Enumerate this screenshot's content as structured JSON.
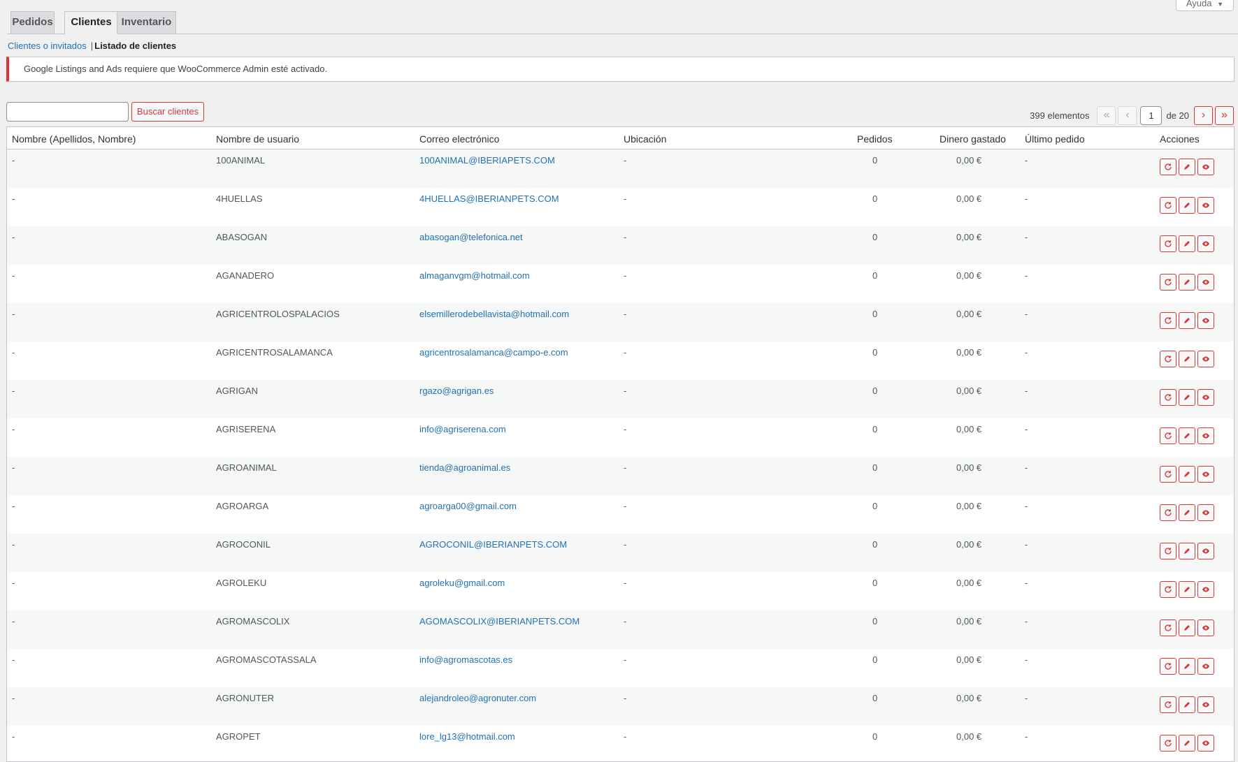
{
  "help": {
    "label": "Ayuda",
    "caret": "▼"
  },
  "tabs": [
    {
      "label": "Pedidos"
    },
    {
      "label": "Clientes"
    },
    {
      "label": "Inventario"
    }
  ],
  "subnav": {
    "link": "Clientes o invitados",
    "separator": "|",
    "current": "Listado de clientes"
  },
  "notice": "Google Listings and Ads requiere que WooCommerce Admin esté activado.",
  "search": {
    "value": "",
    "button": "Buscar clientes"
  },
  "pagination": {
    "count": "399 elementos",
    "first": "«",
    "prev": "‹",
    "current": "1",
    "of": "de 20",
    "next": "›",
    "last": "»"
  },
  "table": {
    "headers": [
      "Nombre (Apellidos, Nombre)",
      "Nombre de usuario",
      "Correo electrónico",
      "Ubicación",
      "Pedidos",
      "Dinero gastado",
      "Último pedido",
      "Acciones"
    ],
    "rows": [
      {
        "name": "-",
        "user": "100ANIMAL",
        "email": "100ANIMAL@IBERIAPETS.COM",
        "location": "-",
        "orders": "0",
        "spent": "0,00 €",
        "last": "-"
      },
      {
        "name": "-",
        "user": "4HUELLAS",
        "email": "4HUELLAS@IBERIANPETS.COM",
        "location": "-",
        "orders": "0",
        "spent": "0,00 €",
        "last": "-"
      },
      {
        "name": "-",
        "user": "ABASOGAN",
        "email": "abasogan@telefonica.net",
        "location": "-",
        "orders": "0",
        "spent": "0,00 €",
        "last": "-"
      },
      {
        "name": "-",
        "user": "AGANADERO",
        "email": "almaganvgm@hotmail.com",
        "location": "-",
        "orders": "0",
        "spent": "0,00 €",
        "last": "-"
      },
      {
        "name": "-",
        "user": "AGRICENTROLOSPALACIOS",
        "email": "elsemillerodebellavista@hotmail.com",
        "location": "-",
        "orders": "0",
        "spent": "0,00 €",
        "last": "-"
      },
      {
        "name": "-",
        "user": "AGRICENTROSALAMANCA",
        "email": "agricentrosalamanca@campo-e.com",
        "location": "-",
        "orders": "0",
        "spent": "0,00 €",
        "last": "-"
      },
      {
        "name": "-",
        "user": "AGRIGAN",
        "email": "rgazo@agrigan.es",
        "location": "-",
        "orders": "0",
        "spent": "0,00 €",
        "last": "-"
      },
      {
        "name": "-",
        "user": "AGRISERENA",
        "email": "info@agriserena.com",
        "location": "-",
        "orders": "0",
        "spent": "0,00 €",
        "last": "-"
      },
      {
        "name": "-",
        "user": "AGROANIMAL",
        "email": "tienda@agroanimal.es",
        "location": "-",
        "orders": "0",
        "spent": "0,00 €",
        "last": "-"
      },
      {
        "name": "-",
        "user": "AGROARGA",
        "email": "agroarga00@gmail.com",
        "location": "-",
        "orders": "0",
        "spent": "0,00 €",
        "last": "-"
      },
      {
        "name": "-",
        "user": "AGROCONIL",
        "email": "AGROCONIL@IBERIANPETS.COM",
        "location": "-",
        "orders": "0",
        "spent": "0,00 €",
        "last": "-"
      },
      {
        "name": "-",
        "user": "AGROLEKU",
        "email": "agroleku@gmail.com",
        "location": "-",
        "orders": "0",
        "spent": "0,00 €",
        "last": "-"
      },
      {
        "name": "-",
        "user": "AGROMASCOLIX",
        "email": "AGOMASCOLIX@IBERIANPETS.COM",
        "location": "-",
        "orders": "0",
        "spent": "0,00 €",
        "last": "-"
      },
      {
        "name": "-",
        "user": "AGROMASCOTASSALA",
        "email": "info@agromascotas.es",
        "location": "-",
        "orders": "0",
        "spent": "0,00 €",
        "last": "-"
      },
      {
        "name": "-",
        "user": "AGRONUTER",
        "email": "alejandroleo@agronuter.com",
        "location": "-",
        "orders": "0",
        "spent": "0,00 €",
        "last": "-"
      },
      {
        "name": "-",
        "user": "AGROPET",
        "email": "lore_lg13@hotmail.com",
        "location": "-",
        "orders": "0",
        "spent": "0,00 €",
        "last": "-"
      }
    ],
    "action_icons": [
      "refresh-icon",
      "edit-icon",
      "view-icon"
    ]
  },
  "colors": {
    "accent": "#d63638",
    "link": "#2271b1"
  }
}
